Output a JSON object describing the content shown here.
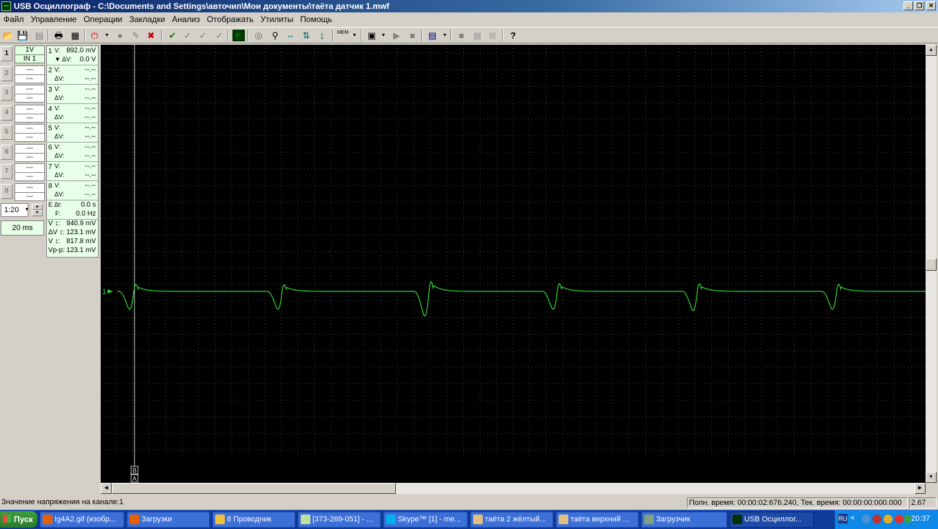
{
  "window": {
    "title": "USB Осциллограф - C:\\Documents and Settings\\авточип\\Мои документы\\таёта датчик 1.mwf"
  },
  "menu": [
    "Файл",
    "Управление",
    "Операции",
    "Закладки",
    "Анализ",
    "Отображать",
    "Утилиты",
    "Помощь"
  ],
  "toolbar": {
    "icons": [
      "open-icon",
      "save-icon",
      "save-as-icon",
      "print-icon",
      "export-icon",
      "stop-icon",
      "record-icon",
      "run-icon",
      "clear-icon",
      "check-icon",
      "check-sub-icon",
      "check-alt-icon",
      "check-multi-icon",
      "display-icon",
      "cursor-icon",
      "binoculars-icon",
      "arrows-icon",
      "marker-icon",
      "measure-icon",
      "memory-icon",
      "compare-icon",
      "play-icon",
      "stop-play-icon",
      "monitor-icon",
      "block-a-icon",
      "block-b-icon",
      "block-c-icon",
      "help-icon"
    ],
    "mem_label": "MEM"
  },
  "channels": [
    {
      "btn": "1",
      "l1": "1V",
      "l2": "IN 1",
      "active": true
    },
    {
      "btn": "2",
      "l1": "---",
      "l2": "---"
    },
    {
      "btn": "3",
      "l1": "---",
      "l2": "---"
    },
    {
      "btn": "4",
      "l1": "---",
      "l2": "---"
    },
    {
      "btn": "5",
      "l1": "---",
      "l2": "---"
    },
    {
      "btn": "6",
      "l1": "---",
      "l2": "---"
    },
    {
      "btn": "7",
      "l1": "---",
      "l2": "---"
    },
    {
      "btn": "8",
      "l1": "---",
      "l2": "---"
    }
  ],
  "scale": {
    "value": "1:20",
    "timebase": "20 ms"
  },
  "measurements": [
    {
      "num": "1",
      "a": "V:",
      "b": "▼ ΔV:",
      "va": "892.0 mV",
      "vb": "0.0 V"
    },
    {
      "num": "2",
      "a": "V:",
      "b": "ΔV:",
      "va": "--.--",
      "vb": "--.--"
    },
    {
      "num": "3",
      "a": "V:",
      "b": "ΔV:",
      "va": "--.--",
      "vb": "--.--"
    },
    {
      "num": "4",
      "a": "V:",
      "b": "ΔV:",
      "va": "--.--",
      "vb": "--.--"
    },
    {
      "num": "5",
      "a": "V:",
      "b": "ΔV:",
      "va": "--.--",
      "vb": "--.--"
    },
    {
      "num": "6",
      "a": "V:",
      "b": "ΔV:",
      "va": "--.--",
      "vb": "--.--"
    },
    {
      "num": "7",
      "a": "V:",
      "b": "ΔV:",
      "va": "--.--",
      "vb": "--.--"
    },
    {
      "num": "8",
      "a": "V:",
      "b": "ΔV:",
      "va": "--.--",
      "vb": "--.--"
    }
  ],
  "timing": {
    "e_label": "E Δt:",
    "e_value": "0.0 s",
    "f_label": "F:",
    "f_value": "0.0 Hz"
  },
  "summary": [
    {
      "label": "V ↕:",
      "value": "940.9 mV"
    },
    {
      "label": "ΔV ↕:",
      "value": "123.1 mV"
    },
    {
      "label": "V ↕:",
      "value": "817.8 mV"
    },
    {
      "label": "Vp-p:",
      "value": "123.1 mV"
    }
  ],
  "scope": {
    "trace_color": "#33dd33",
    "channel_marker": "1",
    "cursor_b": "B",
    "cursor_a": "A"
  },
  "status": {
    "left": "Значение напряжения на канале:1",
    "right": "Полн. время: 00:00:02:676.240, Тек. время: 00:00:00:000.000",
    "zoom": "2.67"
  },
  "taskbar": {
    "start": "Пуск",
    "items": [
      {
        "label": "Ig4A2.gif (изобр...",
        "icon": "firefox-icon"
      },
      {
        "label": "Загрузки",
        "icon": "firefox-icon"
      },
      {
        "label": "8 Проводник",
        "icon": "folder-icon"
      },
      {
        "label": "[373-269-051] - ...",
        "icon": "notepad-icon"
      },
      {
        "label": "Skype™ [1] - me...",
        "icon": "skype-icon"
      },
      {
        "label": "таёта 2 жёлтый...",
        "icon": "paint-icon"
      },
      {
        "label": "таёта верхний ...",
        "icon": "paint-icon"
      },
      {
        "label": "Загрузчик",
        "icon": "downloader-icon"
      },
      {
        "label": "USB Осциллог...",
        "icon": "scope-icon",
        "active": true
      }
    ],
    "lang": "RU",
    "clock": "20:37"
  }
}
